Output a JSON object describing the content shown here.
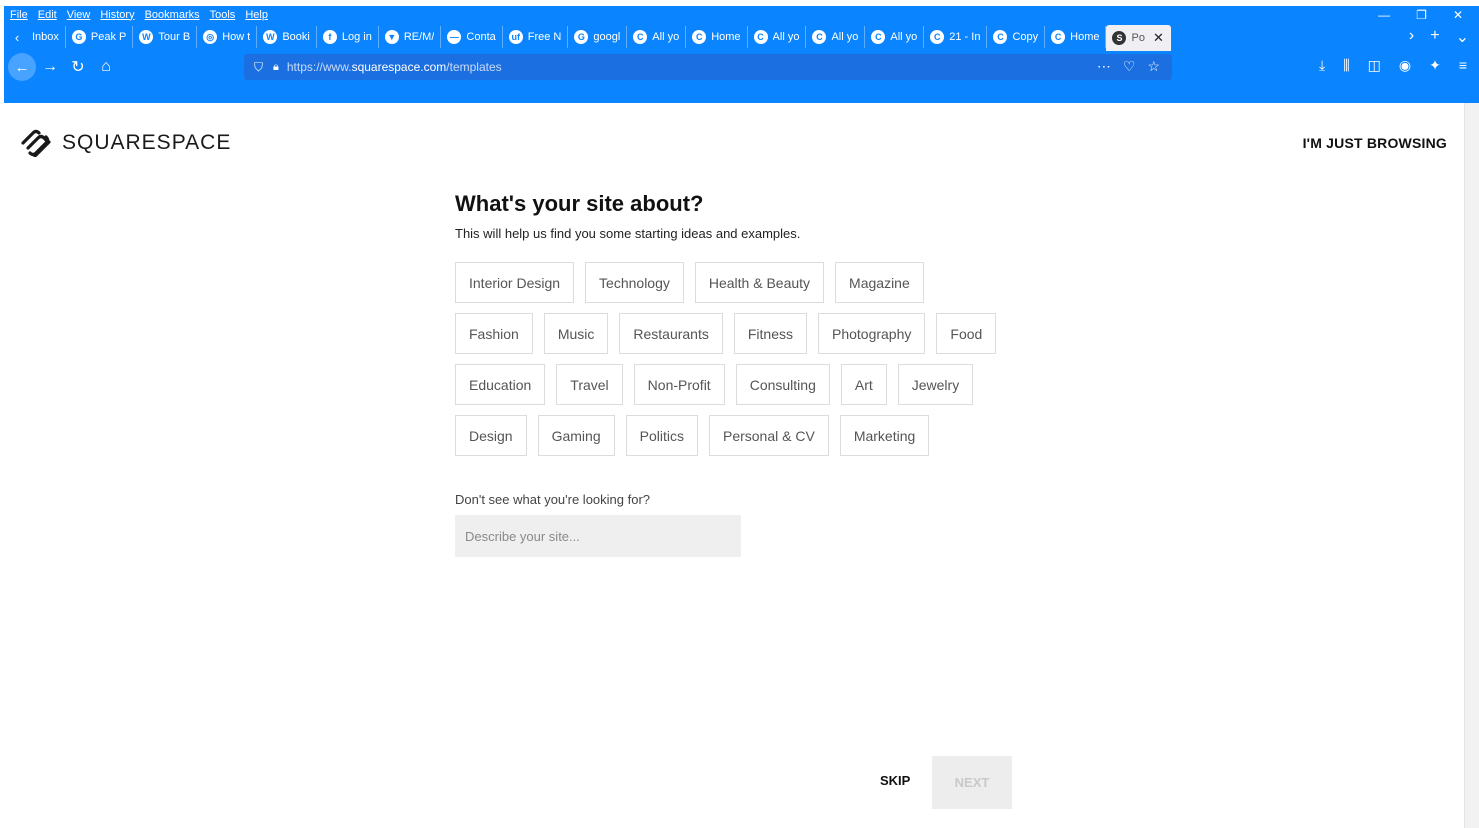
{
  "menubar": [
    "File",
    "Edit",
    "View",
    "History",
    "Bookmarks",
    "Tools",
    "Help"
  ],
  "tabs": [
    {
      "icon": "",
      "label": "Inbox"
    },
    {
      "icon": "G",
      "label": "Peak P"
    },
    {
      "icon": "W",
      "label": "Tour B"
    },
    {
      "icon": "◎",
      "label": "How t"
    },
    {
      "icon": "W",
      "label": "Booki"
    },
    {
      "icon": "f",
      "label": "Log in"
    },
    {
      "icon": "▼",
      "label": "RE/M/"
    },
    {
      "icon": "—",
      "label": "Conta"
    },
    {
      "icon": "uf",
      "label": "Free N"
    },
    {
      "icon": "G",
      "label": "googl"
    },
    {
      "icon": "C",
      "label": "All yo"
    },
    {
      "icon": "C",
      "label": "Home"
    },
    {
      "icon": "C",
      "label": "All yo"
    },
    {
      "icon": "C",
      "label": "All yo"
    },
    {
      "icon": "C",
      "label": "All yo"
    },
    {
      "icon": "C",
      "label": "21 - In"
    },
    {
      "icon": "C",
      "label": "Copy"
    },
    {
      "icon": "C",
      "label": "Home"
    },
    {
      "icon": "S",
      "label": "Po"
    }
  ],
  "url": {
    "prefix": "https://www.",
    "host": "squarespace.com",
    "path": "/templates"
  },
  "brand": {
    "name": "SQUARESPACE",
    "browse": "I'M JUST BROWSING"
  },
  "main": {
    "title": "What's your site about?",
    "subtitle": "This will help us find you some starting ideas and examples.",
    "rows": [
      [
        "Interior Design",
        "Technology",
        "Health & Beauty",
        "Magazine"
      ],
      [
        "Fashion",
        "Music",
        "Restaurants",
        "Fitness",
        "Photography",
        "Food"
      ],
      [
        "Education",
        "Travel",
        "Non-Profit",
        "Consulting",
        "Art",
        "Jewelry"
      ],
      [
        "Design",
        "Gaming",
        "Politics",
        "Personal & CV",
        "Marketing"
      ]
    ],
    "question": "Don't see what you're looking for?",
    "placeholder": "Describe your site..."
  },
  "footer": {
    "skip": "SKIP",
    "next": "NEXT"
  },
  "colors": {
    "chrome": "#0a84ff",
    "chip_border": "#dcdcdc",
    "next_bg": "#ededed"
  }
}
